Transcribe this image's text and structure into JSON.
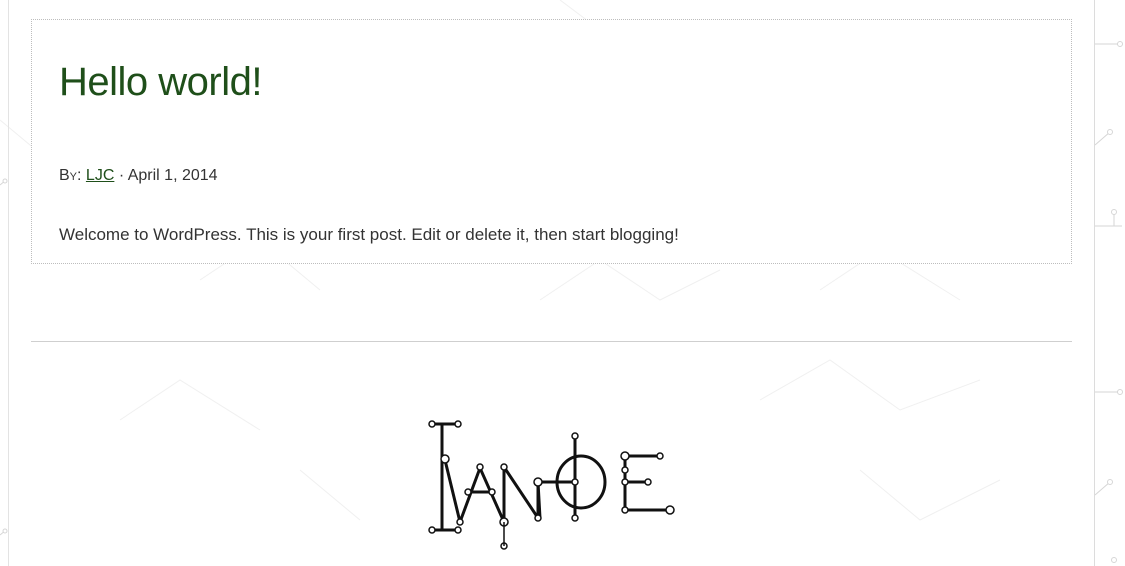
{
  "post": {
    "title": "Hello world!",
    "byline_prefix": "By:",
    "author": "LJC",
    "separator": "·",
    "date": "April 1, 2014",
    "content": "Welcome to WordPress. This is your first post. Edit or delete it, then start blogging!"
  },
  "footer": {
    "logo_text": "IVANHOE"
  },
  "colors": {
    "title": "#1f4f1a",
    "text": "#333333",
    "link": "#1f4f1a",
    "background": "#ffffff"
  }
}
